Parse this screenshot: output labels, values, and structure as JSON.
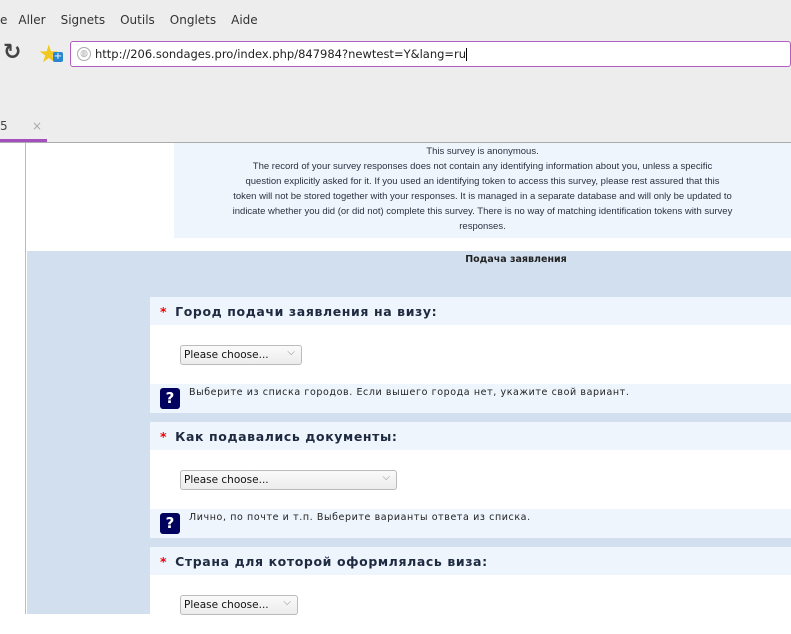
{
  "browser": {
    "menu": [
      "e",
      "Aller",
      "Signets",
      "Outils",
      "Onglets",
      "Aide"
    ],
    "url": "http://206.sondages.pro/index.php/847984?newtest=Y&lang=ru",
    "tab_label": "5",
    "tab_close": "×"
  },
  "notice": {
    "lines": [
      "This survey is anonymous.",
      "The record of your survey responses does not contain any identifying information about you, unless a specific",
      "question explicitly asked for it. If you used an identifying token to access this survey, please rest assured that this",
      "token will not be stored together with your responses. It is managed in a separate database and will only be updated to",
      "indicate whether you did (or did not) complete this survey. There is no way of matching identification tokens with survey",
      "responses."
    ]
  },
  "group_title": "Подача заявления",
  "questions": [
    {
      "required": "*",
      "title": "Город  подачи заявления на визу:",
      "select": "Please choose...",
      "help": "Выберите из списка городов. Если вышего города нет, укажите свой вариант."
    },
    {
      "required": "*",
      "title": "Как подавались документы:",
      "select": "Please choose...",
      "help": "Лично, по почте и т.п. Выберите варианты ответа из списка."
    },
    {
      "required": "*",
      "title": "Страна для которой оформлялась виза:",
      "select": "Please choose..."
    }
  ]
}
